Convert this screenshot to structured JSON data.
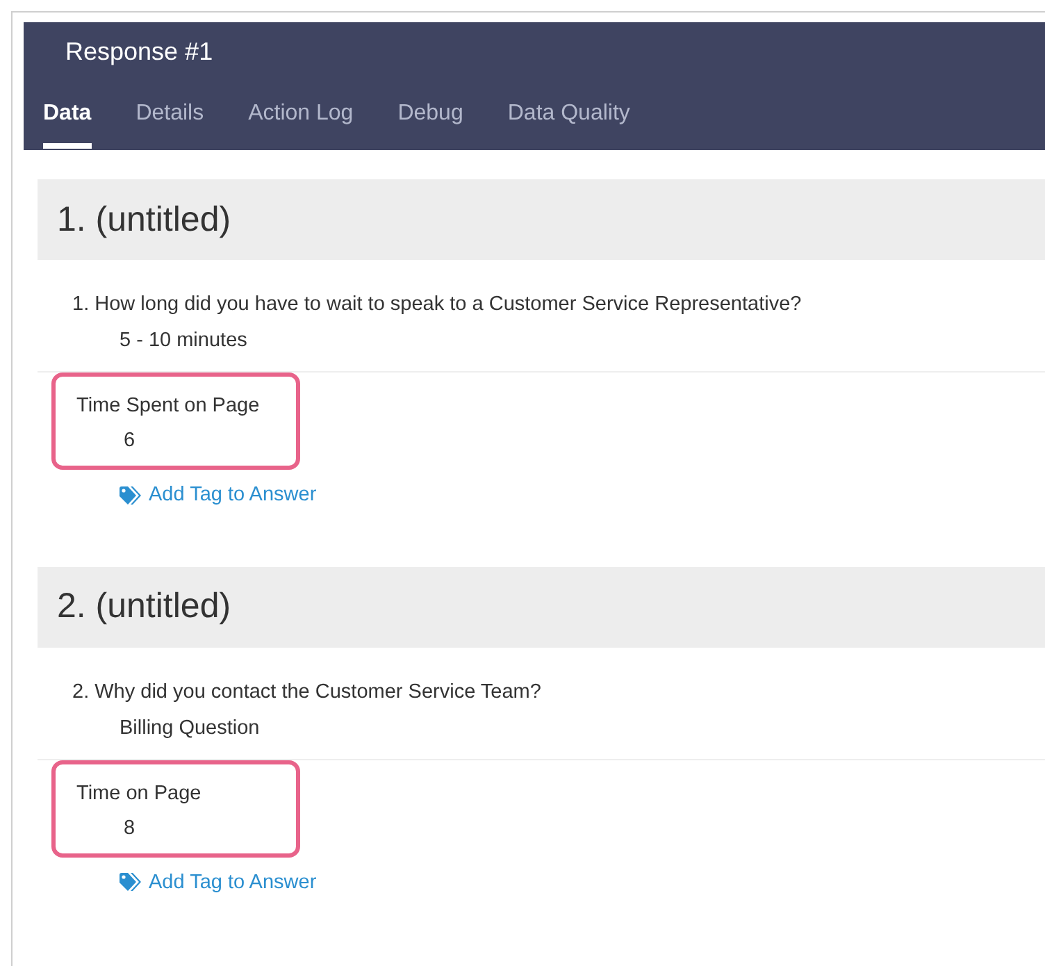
{
  "header": {
    "title": "Response #1"
  },
  "tabs": [
    {
      "label": "Data",
      "selected": true
    },
    {
      "label": "Details",
      "selected": false
    },
    {
      "label": "Action Log",
      "selected": false
    },
    {
      "label": "Debug",
      "selected": false
    },
    {
      "label": "Data Quality",
      "selected": false
    }
  ],
  "sections": [
    {
      "heading": "1. (untitled)",
      "question": "1. How long did you have to wait to speak to a Customer Service Representative?",
      "answer": "5 - 10 minutes",
      "metric": {
        "label": "Time Spent on Page",
        "value": "6",
        "highlighted": true
      },
      "tag_link": "Add Tag to Answer"
    },
    {
      "heading": "2. (untitled)",
      "question": "2. Why did you contact the Customer Service Team?",
      "answer": "Billing Question",
      "metric": {
        "label": "Time on Page",
        "value": "8",
        "highlighted": true
      },
      "tag_link": "Add Tag to Answer"
    }
  ]
}
